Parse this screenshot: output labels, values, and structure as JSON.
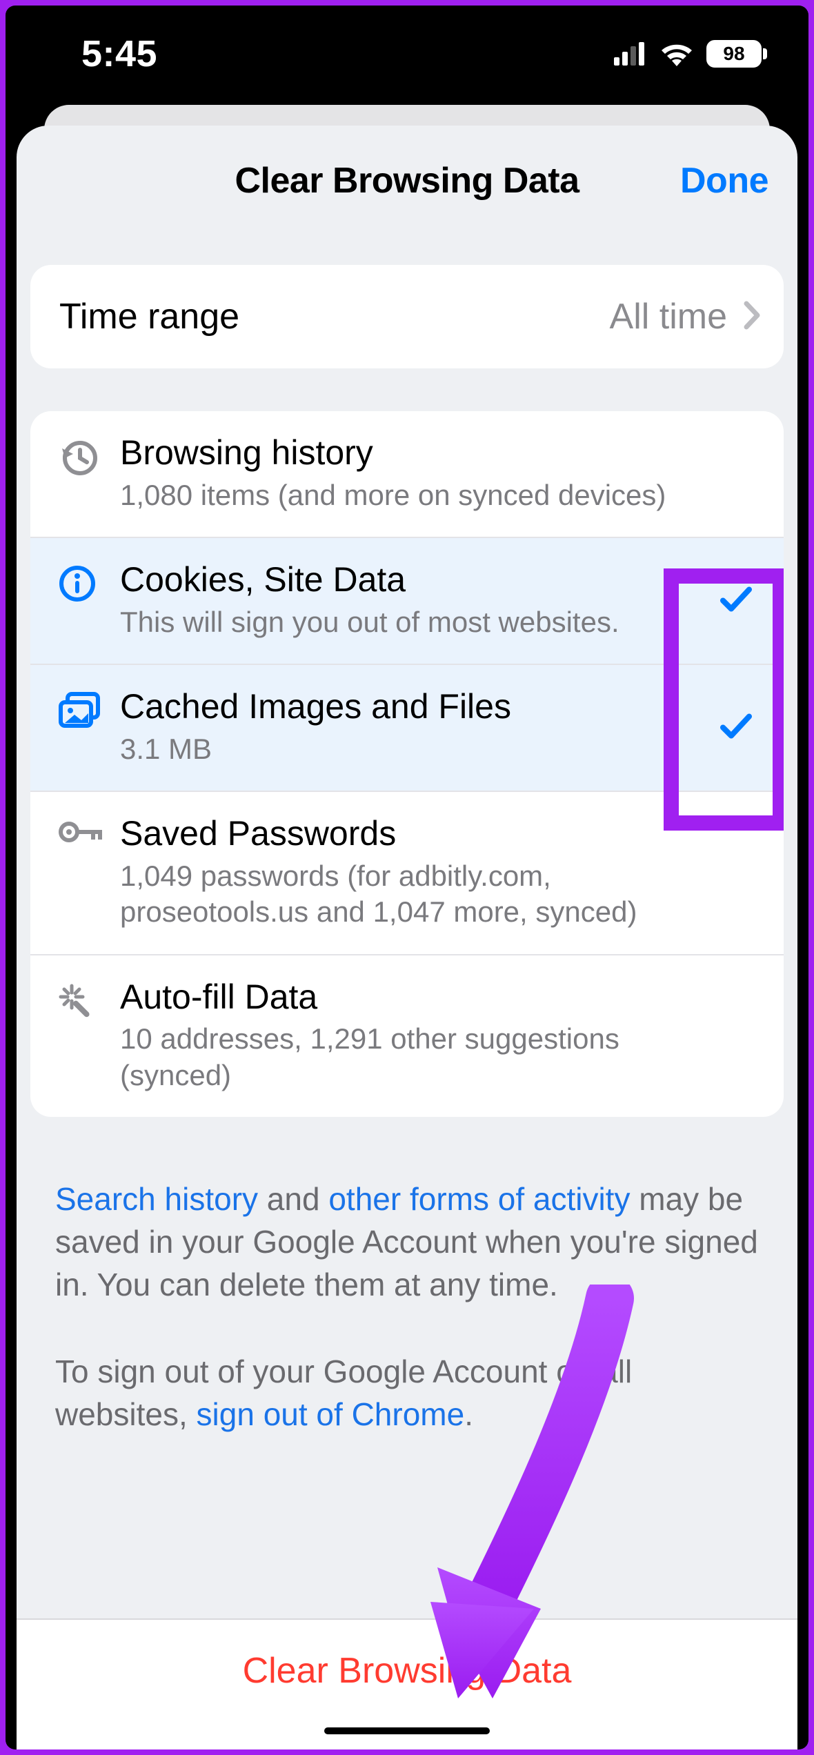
{
  "status": {
    "time": "5:45",
    "battery": "98"
  },
  "sheet": {
    "title": "Clear Browsing Data",
    "done": "Done"
  },
  "time_range": {
    "label": "Time range",
    "value": "All time"
  },
  "types": [
    {
      "title": "Browsing history",
      "sub": "1,080 items (and more on synced devices)"
    },
    {
      "title": "Cookies, Site Data",
      "sub": "This will sign you out of most websites."
    },
    {
      "title": "Cached Images and Files",
      "sub": "3.1 MB"
    },
    {
      "title": "Saved Passwords",
      "sub": "1,049 passwords (for adbitly.com, proseotools.us and 1,047 more, synced)"
    },
    {
      "title": "Auto-fill Data",
      "sub": "10 addresses, 1,291 other suggestions (synced)"
    }
  ],
  "footer": {
    "link_search_history": "Search history",
    "and": " and ",
    "link_other_activity": "other forms of activity",
    "tail1": " may be saved in your Google Account when you're signed in. You can delete them at any time.",
    "p2a": "To sign out of your Google Account on all websites, ",
    "link_signout": "sign out of Chrome",
    "p2b": "."
  },
  "action": {
    "clear": "Clear Browsing Data"
  }
}
